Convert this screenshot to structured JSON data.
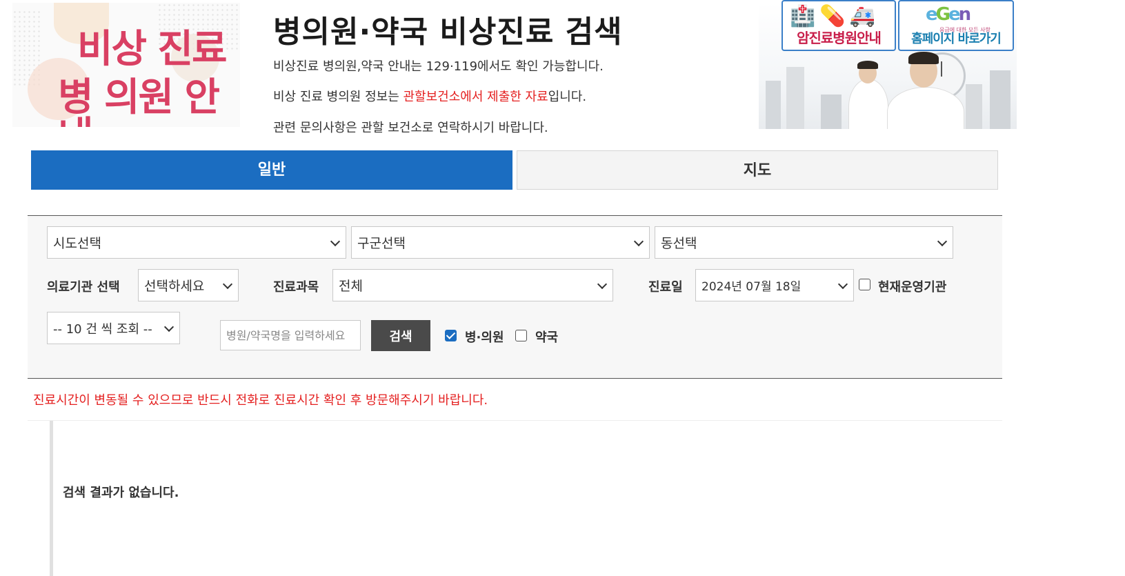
{
  "header": {
    "banner_title_line1": "비상 진료",
    "banner_title_line2": "병 의원 안내",
    "page_title": "병의원·약국 비상진료 검색",
    "info_line1": "비상진료 병의원,약국 안내는 129·119에서도 확인 가능합니다.",
    "info_line2_prefix": "비상 진료 병의원 정보는 ",
    "info_line2_highlight": "관할보건소에서 제출한 자료",
    "info_line2_suffix": "입니다.",
    "info_line3": "관련 문의사항은 관할 보건소로 연락하시기 바랍니다."
  },
  "promo": {
    "cancer_hospital_label": "암진료병원안내",
    "homepage_label": "홈페이지 바로가기",
    "homepage_logo": "eGen",
    "homepage_tagline": "응급에 대한 모든 사항"
  },
  "tabs": {
    "general": "일반",
    "map": "지도"
  },
  "search": {
    "sido": "시도선택",
    "gugun": "구군선택",
    "dong": "동선택",
    "institution_label": "의료기관 선택",
    "institution_value": "선택하세요",
    "department_label": "진료과목",
    "department_value": "전체",
    "date_label": "진료일",
    "date_value": "2024년 07월 18일",
    "operating_now_label": "현재운영기관",
    "operating_now_checked": false,
    "page_size": "-- 10 건 씩 조회 --",
    "name_placeholder": "병원/약국명을 입력하세요",
    "search_button": "검색",
    "hospital_label": "병·의원",
    "hospital_checked": true,
    "pharmacy_label": "약국",
    "pharmacy_checked": false
  },
  "notice": "진료시간이 변동될 수 있으므로 반드시 전화로 진료시간 확인 후 방문해주시기 바랍니다.",
  "results": {
    "empty_message": "검색 결과가 없습니다."
  },
  "colors": {
    "tab_active": "#1b6dc1",
    "notice_red": "#e41f1f",
    "banner_pink": "#d94063"
  }
}
